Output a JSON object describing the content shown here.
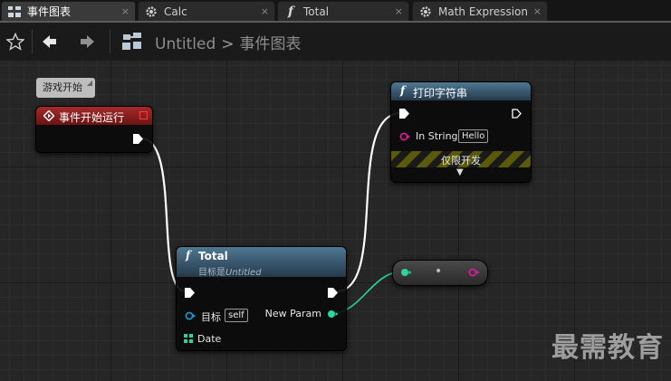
{
  "tabs": [
    {
      "label": "事件图表",
      "icon": "event-graph-icon",
      "active": true
    },
    {
      "label": "Calc",
      "icon": "gear-icon",
      "active": false
    },
    {
      "label": "Total",
      "icon": "function-icon",
      "active": false
    },
    {
      "label": "Math Expression",
      "icon": "gear-icon",
      "active": false
    }
  ],
  "tab_close": "×",
  "toolbar": {
    "favorite_icon": "star-icon",
    "back_icon": "arrow-left-icon",
    "forward_icon": "arrow-right-icon",
    "graph_icon": "graph-icon"
  },
  "breadcrumb": {
    "root": "Untitled",
    "separator": ">",
    "current": "事件图表"
  },
  "comment_bubble": {
    "text": "游戏开始"
  },
  "begin_play_node": {
    "title": "事件开始运行",
    "color": "#8c1c1c"
  },
  "print_node": {
    "title": "打印字符串",
    "in_string_label": "In String",
    "in_string_value": "Hello",
    "dev_only_label": "仅限开发",
    "color": "#3a5a72"
  },
  "total_node": {
    "title": "Total",
    "subtitle_prefix": "目标是",
    "subtitle_target": "Untitled",
    "target_label": "目标",
    "target_value": "self",
    "new_param_label": "New Param",
    "date_label": "Date",
    "color": "#3a5a72"
  },
  "reroute_node": {
    "center_dot": "•"
  },
  "colors": {
    "exec_wire": "#ffffff",
    "float_wire": "#2ad6a0",
    "object_pin": "#1a9bdc",
    "string_pin": "#e0199f"
  },
  "watermark": "最需教育"
}
